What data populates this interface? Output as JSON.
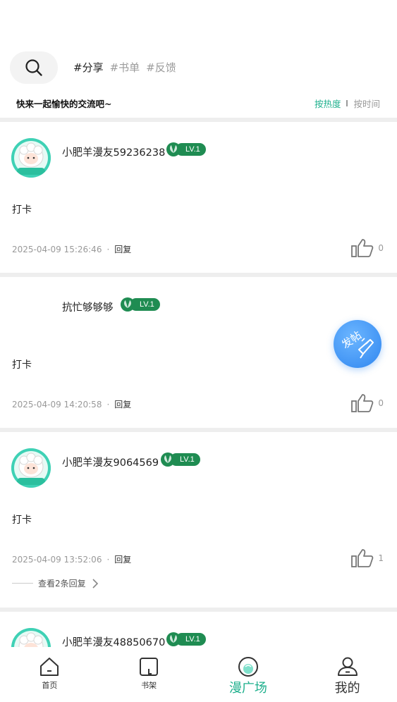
{
  "search": {
    "icon": "search-icon"
  },
  "tags": [
    "#分享",
    "#书单",
    "#反馈"
  ],
  "slogan": "快来一起愉快的交流吧~",
  "sort": {
    "hot": "按热度",
    "time": "按时间"
  },
  "posts": [
    {
      "username": "小肥羊漫友59236238",
      "level": "LV.1",
      "content": "打卡",
      "datetime": "2025-04-09 15:26:46",
      "separator": "·",
      "reply": "回复",
      "likes": "0",
      "has_avatar": true
    },
    {
      "username": "抗忙够够够",
      "level": "LV.1",
      "content": "打卡",
      "datetime": "2025-04-09 14:20:58",
      "separator": "·",
      "reply": "回复",
      "likes": "0",
      "has_avatar": false
    },
    {
      "username": "小肥羊漫友9064569",
      "level": "LV.1",
      "content": "打卡",
      "datetime": "2025-04-09 13:52:06",
      "separator": "·",
      "reply": "回复",
      "likes": "1",
      "has_avatar": true,
      "more_replies": "查看2条回复"
    },
    {
      "username": "小肥羊漫友48850670",
      "level": "LV.1",
      "has_avatar": true
    }
  ],
  "avatar_text": "小肥羊",
  "fab": {
    "label": "发帖",
    "icon": "quill-icon"
  },
  "nav": [
    {
      "label": "首页",
      "icon": "home-icon"
    },
    {
      "label": "书架",
      "icon": "bookshelf-icon"
    },
    {
      "label": "漫广场",
      "icon": "plaza-icon",
      "active": true
    },
    {
      "label": "我的",
      "icon": "profile-icon"
    }
  ],
  "colors": {
    "accent": "#1fb08d",
    "badge": "#1f8c52",
    "fab": "#2f86f0",
    "avatar_bg": "#3fd1b5"
  }
}
